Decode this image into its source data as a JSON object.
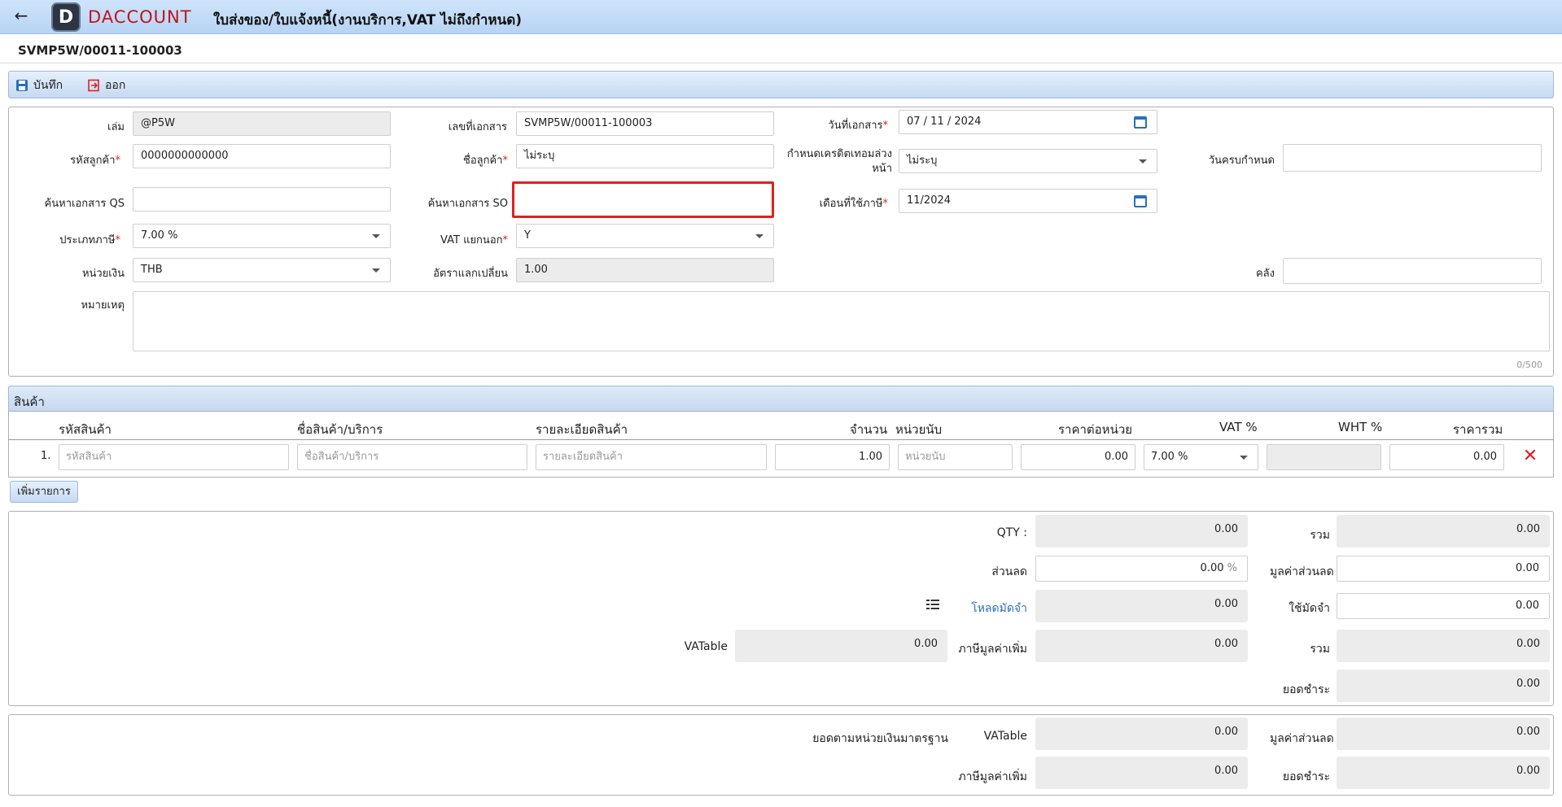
{
  "header": {
    "title": "ใบส่งของ/ใบแจ้งหนี้(งานบริการ,VAT ไม่ถึงกำหนด)",
    "logo_text": "DACCOUNT",
    "logo_letter": "D",
    "back_icon": "arrow-left-icon"
  },
  "doc": {
    "number": "SVMP5W/00011-100003"
  },
  "toolbar": {
    "save_label": "บันทึก",
    "exit_label": "ออก"
  },
  "form": {
    "book_label": "เล่ม",
    "book_value": "@P5W",
    "docno_label": "เลขที่เอกสาร",
    "docno_value": "SVMP5W/00011-100003",
    "docdate_label": "วันที่เอกสาร",
    "docdate_value": "07 / 11 /  2024",
    "custcode_label": "รหัสลูกค้า",
    "custcode_value": "0000000000000",
    "custname_label": "ชื่อลูกค้า",
    "custname_value": "ไม่ระบุ",
    "credit_label_1": "กำหนดเครดิตเทอมล่วง",
    "credit_label_2": "หน้า",
    "credit_value": "ไม่ระบุ",
    "duedate_label": "วันครบกำหนด",
    "duedate_value": "",
    "qs_label": "ค้นหาเอกสาร QS",
    "qs_value": "",
    "so_label": "ค้นหาเอกสาร SO",
    "so_value": "",
    "taxmonth_label": "เดือนที่ใช้ภาษี",
    "taxmonth_value": "11/2024",
    "taxtype_label": "ประเภทภาษี",
    "taxtype_value": "7.00 %",
    "vatsep_label": "VAT แยกนอก",
    "vatsep_value": "Y",
    "currency_label": "หน่วยเงิน",
    "currency_value": "THB",
    "rate_label": "อัตราแลกเปลี่ยน",
    "rate_value": "1.00",
    "warehouse_label": "คลัง",
    "warehouse_value": "",
    "remark_label": "หมายเหตุ",
    "remark_value": "",
    "remark_count": "0/500",
    "req_mark": "*"
  },
  "products": {
    "section_title": "สินค้า",
    "columns": [
      "รหัสสินค้า",
      "ชื่อสินค้า/บริการ",
      "รายละเอียดสินค้า",
      "จำนวน",
      "หน่วยนับ",
      "ราคาต่อหน่วย",
      "VAT %",
      "WHT %",
      "ราคารวม"
    ],
    "rows": [
      {
        "no": "1.",
        "code_ph": "รหัสสินค้า",
        "name_ph": "ชื่อสินค้า/บริการ",
        "detail_ph": "รายละเอียดสินค้า",
        "qty": "1.00",
        "unit_ph": "หน่วยนับ",
        "price": "0.00",
        "vat": "7.00 %",
        "wht": "",
        "total": "0.00"
      }
    ],
    "add_label": "เพิ่มรายการ",
    "delete_icon": "x-icon"
  },
  "summary": {
    "qty_label": "QTY :",
    "qty_value": "0.00",
    "sum_label": "รวม",
    "sum_value": "0.00",
    "discount_label": "ส่วนลด",
    "discount_value": "0.00",
    "discount_unit": "%",
    "discount_amt_label": "มูลค่าส่วนลด",
    "discount_amt_value": "0.00",
    "deposit_link": "โหลดมัดจำ",
    "deposit_value": "0.00",
    "use_deposit_label": "ใช้มัดจำ",
    "use_deposit_value": "0.00",
    "vatable_label": "VATable",
    "vatable_value": "0.00",
    "vat_label": "ภาษีมูลค่าเพิ่ม",
    "vat_value": "0.00",
    "total_label": "รวม",
    "total_value": "0.00",
    "pay_label": "ยอดชำระ",
    "pay_value": "0.00"
  },
  "base_currency": {
    "title": "ยอดตามหน่วยเงินมาตรฐาน",
    "vatable_label": "VATable",
    "vatable_value": "0.00",
    "discount_label": "มูลค่าส่วนลด",
    "discount_value": "0.00",
    "vat_label": "ภาษีมูลค่าเพิ่ม",
    "vat_value": "0.00",
    "pay_label": "ยอดชำระ",
    "pay_value": "0.00"
  },
  "colors": {
    "header": "#c4dcf6",
    "accent": "#2a6fbd",
    "brand": "#c0141a",
    "highlight": "#e02020"
  }
}
